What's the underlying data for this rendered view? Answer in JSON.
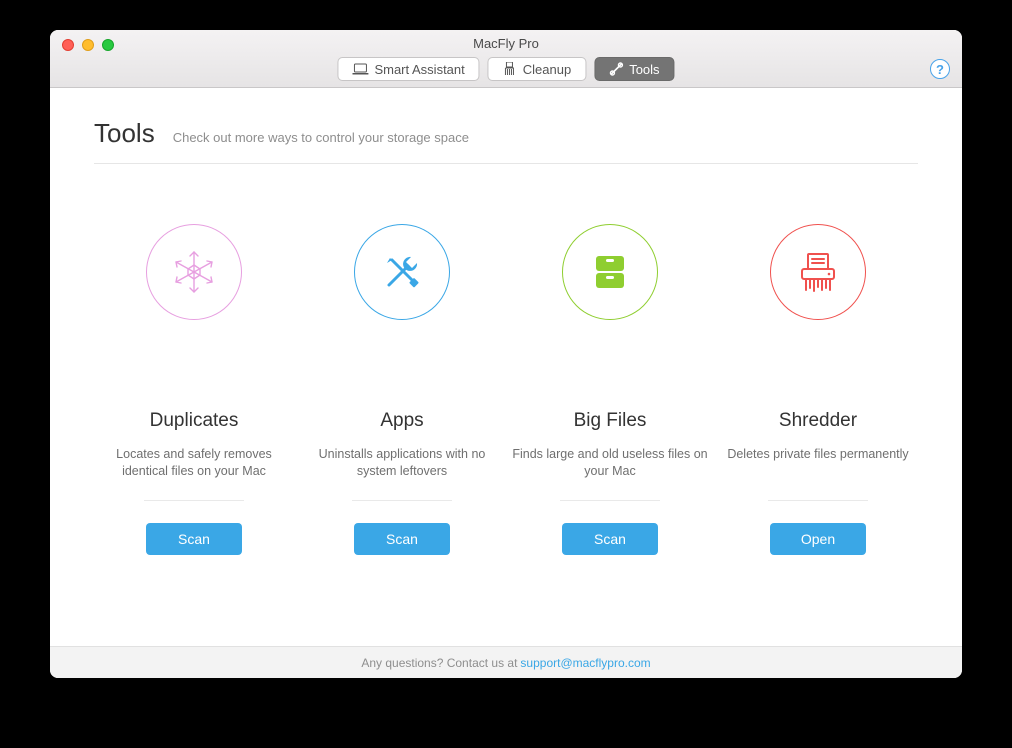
{
  "window": {
    "title": "MacFly Pro"
  },
  "tabs": {
    "smart_assistant": "Smart Assistant",
    "cleanup": "Cleanup",
    "tools": "Tools"
  },
  "help_label": "?",
  "page": {
    "title": "Tools",
    "subtitle": "Check out more ways to control your storage space"
  },
  "cards": {
    "duplicates": {
      "title": "Duplicates",
      "desc": "Locates and safely removes identical files on your Mac",
      "button": "Scan"
    },
    "apps": {
      "title": "Apps",
      "desc": "Uninstalls applications with no system leftovers",
      "button": "Scan"
    },
    "bigfiles": {
      "title": "Big Files",
      "desc": "Finds large and old useless files on your Mac",
      "button": "Scan"
    },
    "shredder": {
      "title": "Shredder",
      "desc": "Deletes private files permanently",
      "button": "Open"
    }
  },
  "footer": {
    "text": "Any questions? Contact us at",
    "link": "support@macflypro.com"
  }
}
